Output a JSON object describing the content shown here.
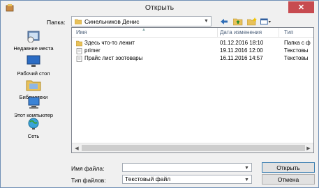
{
  "window": {
    "title": "Открыть",
    "close_label": "✕"
  },
  "lookin": {
    "label": "Папка:",
    "value": "Синельников Денис"
  },
  "places": [
    {
      "label": "Недавние места",
      "icon": "recent-places-icon"
    },
    {
      "label": "Рабочий стол",
      "icon": "desktop-icon"
    },
    {
      "label": "Библиотеки",
      "icon": "libraries-icon"
    },
    {
      "label": "Этот компьютер",
      "icon": "computer-icon"
    },
    {
      "label": "Сеть",
      "icon": "network-icon"
    }
  ],
  "columns": {
    "name": "Имя",
    "date": "Дата изменения",
    "type": "Тип"
  },
  "files": [
    {
      "name": "Здесь что-то лежит",
      "date": "01.12.2016 18:10",
      "type": "Папка с ф",
      "kind": "folder"
    },
    {
      "name": "primer",
      "date": "19.11.2016 12:00",
      "type": "Текстовы",
      "kind": "text"
    },
    {
      "name": "Прайс лист зоотовары",
      "date": "16.11.2016 14:57",
      "type": "Текстовы",
      "kind": "text"
    }
  ],
  "filename": {
    "label": "Имя файла:",
    "value": ""
  },
  "filetype": {
    "label": "Тип файлов:",
    "value": "Текстовый файл"
  },
  "buttons": {
    "open": "Открыть",
    "cancel": "Отмена"
  },
  "colors": {
    "close": "#c74b50",
    "folder": "#e8c15a",
    "header_text": "#4c607a"
  }
}
